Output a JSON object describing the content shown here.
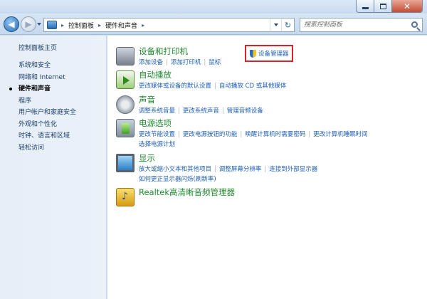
{
  "window": {
    "controls": {
      "minimize": "minimize-icon",
      "maximize": "maximize-icon",
      "close": "close-icon"
    }
  },
  "navbar": {
    "breadcrumbs": [
      "控制面板",
      "硬件和声音"
    ],
    "search_placeholder": "搜索控制面板"
  },
  "leftpane": {
    "home": "控制面板主页",
    "items": [
      {
        "label": "系统和安全",
        "active": false
      },
      {
        "label": "网络和 Internet",
        "active": false
      },
      {
        "label": "硬件和声音",
        "active": true
      },
      {
        "label": "程序",
        "active": false
      },
      {
        "label": "用户帐户和家庭安全",
        "active": false
      },
      {
        "label": "外观和个性化",
        "active": false
      },
      {
        "label": "时钟、语言和区域",
        "active": false
      },
      {
        "label": "轻松访问",
        "active": false
      }
    ]
  },
  "categories": [
    {
      "title": "设备和打印机",
      "icon": "printer-icon",
      "links": [
        "添加设备",
        "添加打印机",
        "鼠标",
        "设备管理器"
      ]
    },
    {
      "title": "自动播放",
      "icon": "autoplay-icon",
      "links": [
        "更改媒体或设备的默认设置",
        "自动播放 CD 或其他媒体"
      ]
    },
    {
      "title": "声音",
      "icon": "speaker-icon",
      "links": [
        "调整系统音量",
        "更改系统声音",
        "管理音频设备"
      ]
    },
    {
      "title": "电源选项",
      "icon": "power-icon",
      "links": [
        "更改节能设置",
        "更改电源按钮的功能",
        "唤醒计算机时需要密码",
        "更改计算机睡眠时间",
        "选择电源计划"
      ]
    },
    {
      "title": "显示",
      "icon": "display-icon",
      "links": [
        "放大或缩小文本和其他项目",
        "调整屏幕分辨率",
        "连接到外部显示器",
        "如何更正显示器闪烁(刷新率)"
      ]
    },
    {
      "title": "Realtek高清晰音频管理器",
      "icon": "realtek-icon",
      "links": []
    }
  ],
  "colors": {
    "accent_link": "#1d5fb8",
    "category_title": "#1f8a2e",
    "highlight_box": "#d4232a"
  }
}
